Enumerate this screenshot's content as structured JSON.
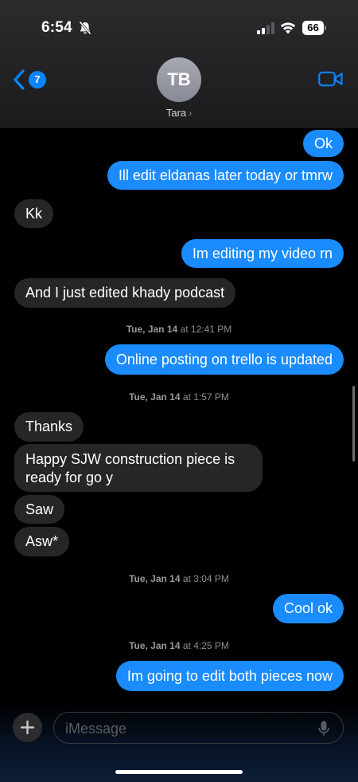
{
  "status_bar": {
    "time": "6:54",
    "battery": "66"
  },
  "header": {
    "unread_count": "7",
    "avatar_initials": "TB",
    "contact_name": "Tara"
  },
  "messages": [
    {
      "dir": "out",
      "text": "Ok"
    },
    {
      "dir": "out",
      "text": "Ill edit eldanas later today or tmrw"
    },
    {
      "dir": "in",
      "text": "Kk"
    },
    {
      "dir": "out",
      "text": "Im editing my video rn"
    },
    {
      "dir": "in",
      "text": "And I just edited khady podcast"
    },
    {
      "dir": "out",
      "text": "Online posting on trello is updated"
    },
    {
      "dir": "in",
      "text": "Thanks"
    },
    {
      "dir": "in",
      "text": "Happy SJW construction piece is ready for go y"
    },
    {
      "dir": "in",
      "text": "Saw"
    },
    {
      "dir": "in",
      "text": "Asw*"
    },
    {
      "dir": "out",
      "text": "Cool ok"
    },
    {
      "dir": "out",
      "text": "Im going to edit both pieces now"
    }
  ],
  "timestamps": [
    {
      "day": "Tue, Jan 14",
      "time": "12:41 PM"
    },
    {
      "day": "Tue, Jan 14",
      "time": "1:57 PM"
    },
    {
      "day": "Tue, Jan 14",
      "time": "3:04 PM"
    },
    {
      "day": "Tue, Jan 14",
      "time": "4:25 PM"
    }
  ],
  "composer": {
    "placeholder": "iMessage"
  },
  "colors": {
    "outgoing_bubble": "#1a8cff",
    "incoming_bubble": "#262628",
    "accent": "#0a84ff"
  },
  "icons": [
    "bell-slash-icon",
    "signal-icon",
    "wifi-icon",
    "battery-icon",
    "chevron-left-icon",
    "video-camera-icon",
    "plus-icon",
    "microphone-icon"
  ]
}
